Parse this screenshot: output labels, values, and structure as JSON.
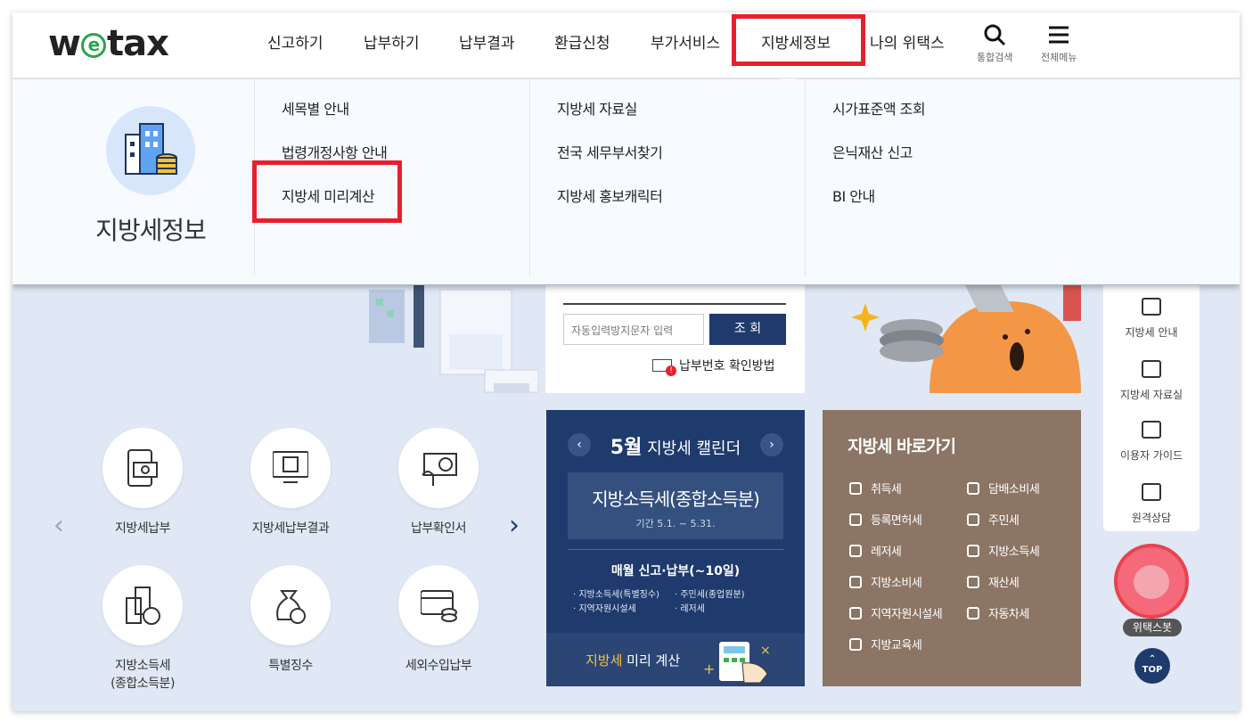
{
  "logo": {
    "prefix": "w",
    "e": "e",
    "suffix": "tax"
  },
  "gnb": [
    {
      "label": "신고하기"
    },
    {
      "label": "납부하기"
    },
    {
      "label": "납부결과"
    },
    {
      "label": "환급신청"
    },
    {
      "label": "부가서비스"
    },
    {
      "label": "지방세정보"
    },
    {
      "label": "나의 위택스"
    }
  ],
  "utils": {
    "search": "통합검색",
    "menu": "전체메뉴"
  },
  "mega": {
    "hero_title": "지방세정보",
    "col1": [
      "세목별 안내",
      "법령개정사항 안내",
      "지방세 미리계산"
    ],
    "col2": [
      "지방세 자료실",
      "전국 세무부서찾기",
      "지방세 홍보캐릭터"
    ],
    "col3": [
      "시가표준액 조회",
      "은닉재산 신고",
      "BI 안내"
    ]
  },
  "lookup": {
    "captcha_placeholder": "자동입력방지문자 입력",
    "search_button": "조 회",
    "confirm_link": "납부번호 확인방법"
  },
  "quick_menu": [
    {
      "label": "지방세납부"
    },
    {
      "label": "지방세납부결과"
    },
    {
      "label": "납부확인서"
    },
    {
      "label": "지방소득세\n(종합소득분)"
    },
    {
      "label": "특별징수"
    },
    {
      "label": "세외수입납부"
    }
  ],
  "calendar": {
    "month": "5월",
    "title": "지방세 캘린더",
    "tax_name": "지방소득세(종합소득분)",
    "period": "기간 5.1. ~ 5.31.",
    "monthly": "매월 신고·납부(~10일)",
    "items": [
      "지방소득세(특별징수)",
      "주민세(종업원분)",
      "지역자원시설세",
      "레저세"
    ],
    "footer_highlight": "지방세",
    "footer_rest": " 미리 계산"
  },
  "shortcut": {
    "title": "지방세 바로가기",
    "items": [
      "취득세",
      "담배소비세",
      "등록면허세",
      "주민세",
      "레저세",
      "지방소득세",
      "지방소비세",
      "재산세",
      "지역자원시설세",
      "자동차세",
      "지방교육세"
    ]
  },
  "side_menu": [
    "지방세 안내",
    "지방세 자료실",
    "이용자 가이드",
    "원격상담"
  ],
  "bot_label": "위택스봇",
  "top_label": "TOP",
  "colors": {
    "highlight": "#e8202b",
    "navy": "#1f3a6d",
    "brown": "#8c7564",
    "green": "#2aa54a"
  }
}
